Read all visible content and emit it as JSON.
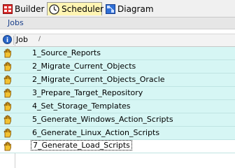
{
  "tabs": [
    {
      "label": "Builder",
      "icon": "red-grid-icon",
      "active": false
    },
    {
      "label": "Scheduler",
      "icon": "clock-icon",
      "active": true
    },
    {
      "label": "Diagram",
      "icon": "blue-diagram-icon",
      "active": false
    }
  ],
  "section": {
    "title": "Jobs"
  },
  "table": {
    "column_header": "Job",
    "sort_indicator": "/",
    "header_icon": "info-circle-icon",
    "rows": [
      {
        "label": "1_Source_Reports",
        "icon": "hand-icon",
        "selected": false
      },
      {
        "label": "2_Migrate_Current_Objects",
        "icon": "hand-icon",
        "selected": false
      },
      {
        "label": "2_Migrate_Current_Objects_Oracle",
        "icon": "hand-icon",
        "selected": false
      },
      {
        "label": "3_Prepare_Target_Repository",
        "icon": "hand-icon",
        "selected": false
      },
      {
        "label": "4_Set_Storage_Templates",
        "icon": "hand-icon",
        "selected": false
      },
      {
        "label": "5_Generate_Windows_Action_Scripts",
        "icon": "hand-icon",
        "selected": false
      },
      {
        "label": "6_Generate_Linux_Action_Scripts",
        "icon": "hand-icon",
        "selected": false
      },
      {
        "label": "7_Generate_Load_Scripts",
        "icon": "hand-icon",
        "selected": true
      }
    ]
  },
  "colors": {
    "row_bg": "#d6f6f4",
    "active_tab": "#fff5b3",
    "section_text": "#1a3f8a"
  }
}
